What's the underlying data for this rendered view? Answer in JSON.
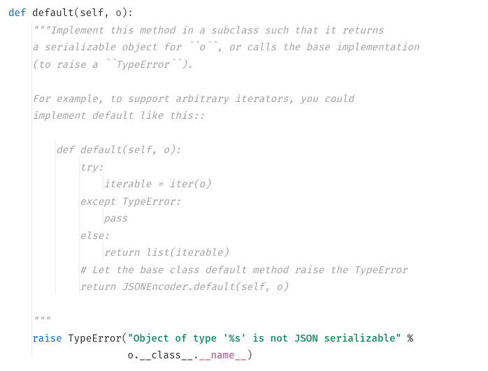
{
  "code": {
    "l1_def": "def",
    "l1_fn": " default",
    "l1_open": "(",
    "l1_self": "self",
    "l1_comma": ", o):",
    "d1": "\"\"\"Implement this method in a subclass such that it returns",
    "d2": "a serializable object for ``o``, or calls the base implementation",
    "d3": "(to raise a ``TypeError``).",
    "d4": "",
    "d5": "For example, to support arbitrary iterators, you could",
    "d6": "implement default like this::",
    "d7": "",
    "d8": "    def default(self, o):",
    "d9": "        try:",
    "d10": "            iterable = iter(o)",
    "d11": "        except TypeError:",
    "d12": "            pass",
    "d13": "        else:",
    "d14": "            return list(iterable)",
    "d15": "        # Let the base class default method raise the TypeError",
    "d16": "        return JSONEncoder.default(self, o)",
    "d17": "",
    "d18": "\"\"\"",
    "r_raise": "raise",
    "r_cls": " TypeError",
    "r_open": "(",
    "r_str": "\"Object of type '%s' is not JSON serializable\"",
    "r_pct": " %",
    "r2_o": "o.",
    "r2_class": "__class__",
    "r2_dot": ".",
    "r2_name": "__name__",
    "r2_close": ")"
  }
}
